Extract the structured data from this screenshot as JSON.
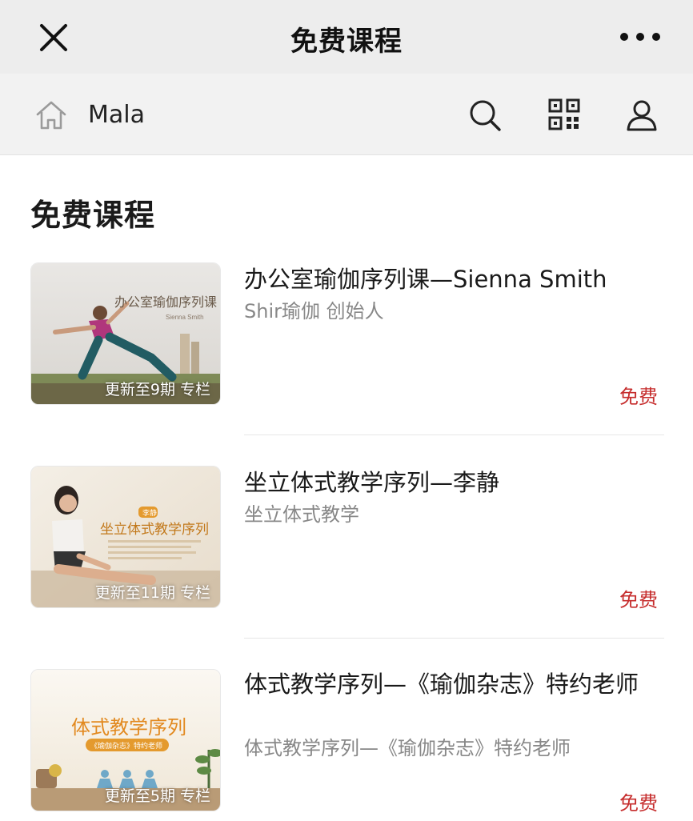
{
  "topbar": {
    "title": "免费课程",
    "close_icon": "close-icon",
    "more_icon": "more-dots-icon"
  },
  "subbar": {
    "shop_name": "Mala",
    "icons": [
      "home-icon",
      "search-icon",
      "qr-code-icon",
      "user-icon"
    ]
  },
  "section": {
    "title": "免费课程"
  },
  "courses": [
    {
      "title": "办公室瑜伽序列课—Sienna Smith",
      "subtitle": "Shir瑜伽 创始人",
      "badge": "更新至9期 专栏",
      "price": "免费",
      "cover_text": "办公室瑜伽序列课",
      "cover_sub": "Sienna Smith"
    },
    {
      "title": "坐立体式教学序列—李静",
      "subtitle": "坐立体式教学",
      "badge": "更新至11期 专栏",
      "price": "免费",
      "cover_text": "坐立体式教学序列",
      "cover_tag": "李静"
    },
    {
      "title": "体式教学序列—《瑜伽杂志》特约老师",
      "subtitle": "体式教学序列—《瑜伽杂志》特约老师",
      "badge": "更新至5期 专栏",
      "price": "免费",
      "cover_text": "体式教学序列",
      "cover_sub": "《瑜伽杂志》特约老师"
    }
  ],
  "colors": {
    "topbar_bg": "#ededed",
    "price": "#c62d2d",
    "subtitle": "#888888"
  }
}
